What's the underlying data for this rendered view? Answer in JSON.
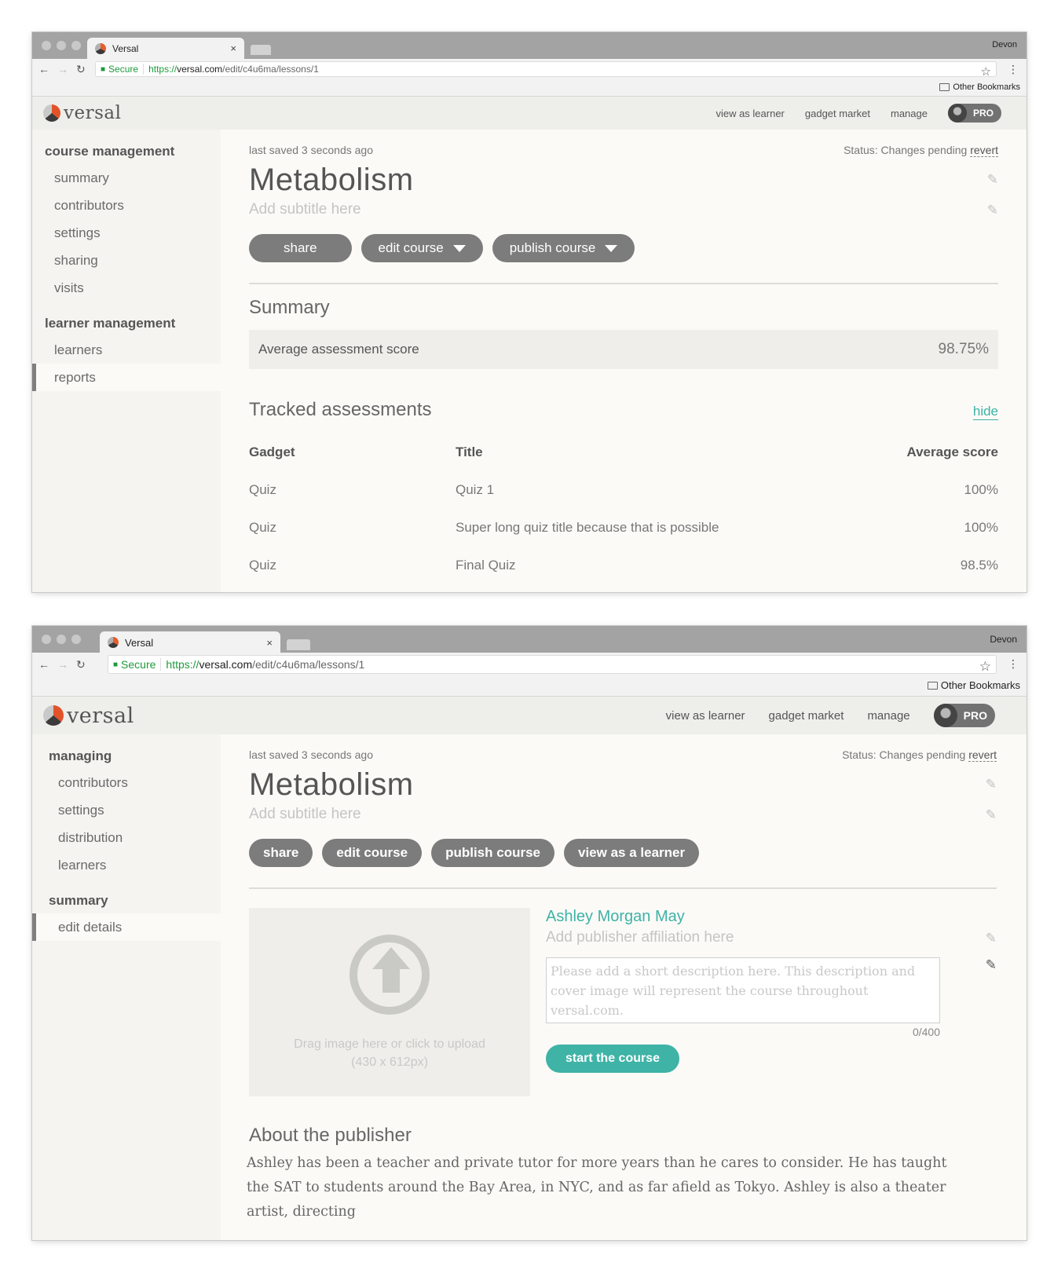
{
  "browser": {
    "tab_title": "Versal",
    "tab_close": "×",
    "profile": "Devon",
    "secure": "Secure",
    "url_scheme": "https://",
    "url_host": "versal.com",
    "url_path": "/edit/c4u6ma/lessons/1",
    "bookmarks": "Other Bookmarks"
  },
  "app": {
    "logo": "versal",
    "nav": [
      "view as learner",
      "gadget market",
      "manage"
    ],
    "pro": "PRO"
  },
  "common": {
    "last_saved": "last saved 3 seconds ago",
    "status": "Status: Changes pending",
    "revert": "revert",
    "title": "Metabolism",
    "subtitle": "Add subtitle here"
  },
  "screen1": {
    "sidebar": {
      "section1": "course management",
      "items1": [
        "summary",
        "contributors",
        "settings",
        "sharing",
        "visits"
      ],
      "section2": "learner management",
      "items2": [
        "learners",
        "reports"
      ]
    },
    "buttons": {
      "share": "share",
      "edit": "edit course",
      "publish": "publish course"
    },
    "summary_heading": "Summary",
    "avg_label": "Average assessment score",
    "avg_value": "98.75%",
    "tracked_heading": "Tracked assessments",
    "hide": "hide",
    "table": {
      "headers": [
        "Gadget",
        "Title",
        "Average score"
      ],
      "rows": [
        [
          "Quiz",
          "Quiz 1",
          "100%"
        ],
        [
          "Quiz",
          "Super long quiz title because that is possible",
          "100%"
        ],
        [
          "Quiz",
          "Final Quiz",
          "98.5%"
        ]
      ]
    }
  },
  "screen2": {
    "sidebar": {
      "section1": "managing",
      "items1": [
        "contributors",
        "settings",
        "distribution",
        "learners"
      ],
      "section2": "summary",
      "items2": [
        "edit details"
      ]
    },
    "buttons": {
      "share": "share",
      "edit": "edit course",
      "publish": "publish course",
      "view": "view as a learner"
    },
    "upload_line1": "Drag image here or click to upload",
    "upload_line2": "(430 x 612px)",
    "publisher_name": "Ashley Morgan May",
    "affiliation": "Add publisher affiliation here",
    "description_placeholder": "Please add a short description here. This description and cover image will represent the course throughout versal.com.",
    "counter": "0/400",
    "start": "start the course",
    "about_heading": "About the publisher",
    "about_text": "Ashley has been a teacher and private tutor for more years than he cares to consider. He has taught the SAT to students around the Bay Area, in NYC, and as far afield as Tokyo. Ashley is also a theater artist, directing"
  }
}
